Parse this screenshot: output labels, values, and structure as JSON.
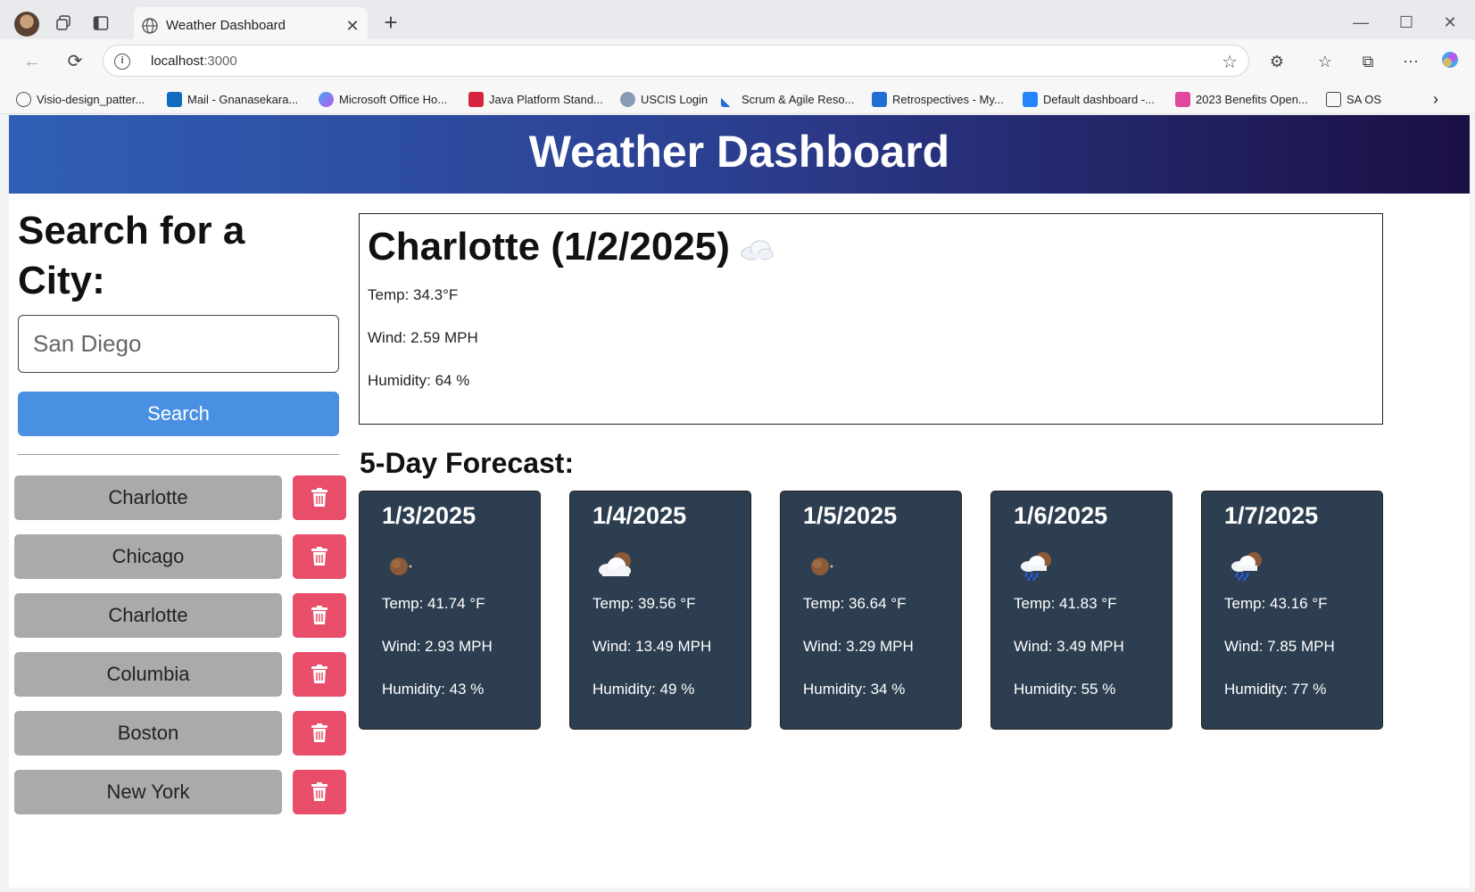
{
  "browser": {
    "tab_title": "Weather Dashboard",
    "url_host": "localhost",
    "url_port": ":3000",
    "bookmarks": [
      "Visio-design_patter...",
      "Mail - Gnanasekara...",
      "Microsoft Office Ho...",
      "Java Platform Stand...",
      "USCIS Login",
      "Scrum & Agile Reso...",
      "Retrospectives - My...",
      "Default dashboard -...",
      "2023 Benefits Open...",
      "SA OS"
    ]
  },
  "app": {
    "title": "Weather Dashboard",
    "search_title": "Search for a City:",
    "search_placeholder": "San Diego",
    "search_button": "Search",
    "history": [
      "Charlotte",
      "Chicago",
      "Charlotte",
      "Columbia",
      "Boston",
      "New York"
    ]
  },
  "current": {
    "heading": "Charlotte (1/2/2025)",
    "temp": "Temp: 34.3°F",
    "wind": "Wind: 2.59 MPH",
    "humidity": "Humidity: 64 %",
    "icon": "cloud-icon"
  },
  "forecast": {
    "title": "5-Day Forecast:",
    "days": [
      {
        "date": "1/3/2025",
        "icon": "clear-night-icon",
        "temp": "Temp: 41.74 °F",
        "wind": "Wind: 2.93 MPH",
        "humidity": "Humidity: 43 %"
      },
      {
        "date": "1/4/2025",
        "icon": "partly-cloudy-night-icon",
        "temp": "Temp: 39.56 °F",
        "wind": "Wind: 13.49 MPH",
        "humidity": "Humidity: 49 %"
      },
      {
        "date": "1/5/2025",
        "icon": "clear-night-icon",
        "temp": "Temp: 36.64 °F",
        "wind": "Wind: 3.29 MPH",
        "humidity": "Humidity: 34 %"
      },
      {
        "date": "1/6/2025",
        "icon": "rain-night-icon",
        "temp": "Temp: 41.83 °F",
        "wind": "Wind: 3.49 MPH",
        "humidity": "Humidity: 55 %"
      },
      {
        "date": "1/7/2025",
        "icon": "rain-night-icon",
        "temp": "Temp: 43.16 °F",
        "wind": "Wind: 7.85 MPH",
        "humidity": "Humidity: 77 %"
      }
    ]
  },
  "colors": {
    "search_button": "#4a90e2",
    "delete_button": "#e84d6a",
    "forecast_card": "#2d3e50",
    "history_button": "#aaaaaa"
  }
}
